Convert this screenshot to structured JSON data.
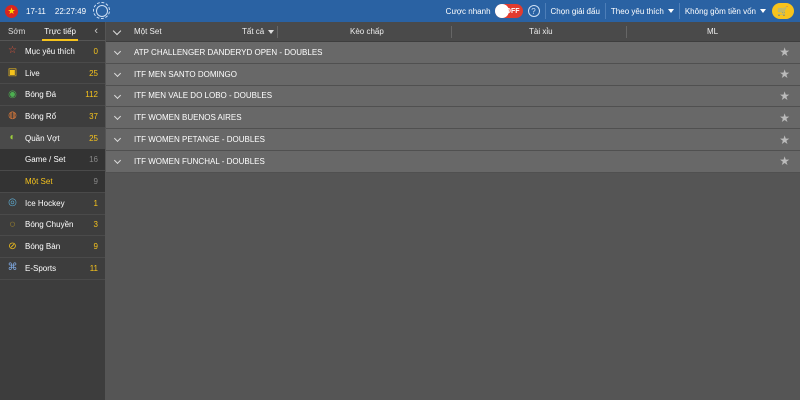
{
  "topbar": {
    "date": "17-11",
    "time": "22:27:49",
    "quick_bet_label": "Cược nhanh",
    "toggle_state": "OFF",
    "help": "?",
    "select_league": "Chọn giải đấu",
    "sort_by": "Theo yêu thích",
    "stake_option": "Không gồm tiền vốn"
  },
  "sidebar": {
    "tabs": {
      "early": "Sớm",
      "live": "Trực tiếp"
    },
    "items": [
      {
        "label": "Mục yêu thích",
        "count": "0",
        "icon": "star-icon"
      },
      {
        "label": "Live",
        "count": "25",
        "icon": "tv-icon"
      },
      {
        "label": "Bóng Đá",
        "count": "112",
        "icon": "soccer-ball-icon"
      },
      {
        "label": "Bóng Rổ",
        "count": "37",
        "icon": "basketball-icon"
      },
      {
        "label": "Quần Vợt",
        "count": "25",
        "icon": "tennis-ball-icon"
      },
      {
        "label": "Game / Set",
        "count": "16"
      },
      {
        "label": "Một Set",
        "count": "9"
      },
      {
        "label": "Ice Hockey",
        "count": "1",
        "icon": "hockey-puck-icon"
      },
      {
        "label": "Bóng Chuyền",
        "count": "3",
        "icon": "volleyball-icon"
      },
      {
        "label": "Bóng Bàn",
        "count": "9",
        "icon": "table-tennis-icon"
      },
      {
        "label": "E-Sports",
        "count": "11",
        "icon": "gamepad-icon"
      }
    ]
  },
  "main": {
    "header": {
      "market": "Một Set",
      "filter": "Tất cả",
      "handicap": "Kèo chấp",
      "over_under": "Tài xỉu",
      "moneyline": "ML"
    },
    "leagues": [
      "ATP CHALLENGER DANDERYD OPEN - DOUBLES",
      "ITF MEN SANTO DOMINGO",
      "ITF MEN VALE DO LOBO - DOUBLES",
      "ITF WOMEN BUENOS AIRES",
      "ITF WOMEN PETANGE - DOUBLES",
      "ITF WOMEN FUNCHAL - DOUBLES"
    ]
  },
  "colors": {
    "topbar": "#2a62a3",
    "accent": "#f6c31c",
    "toggle_off": "#e23b2f",
    "sidebar_bg": "#3d3d3d",
    "row_bg": "#686868"
  }
}
